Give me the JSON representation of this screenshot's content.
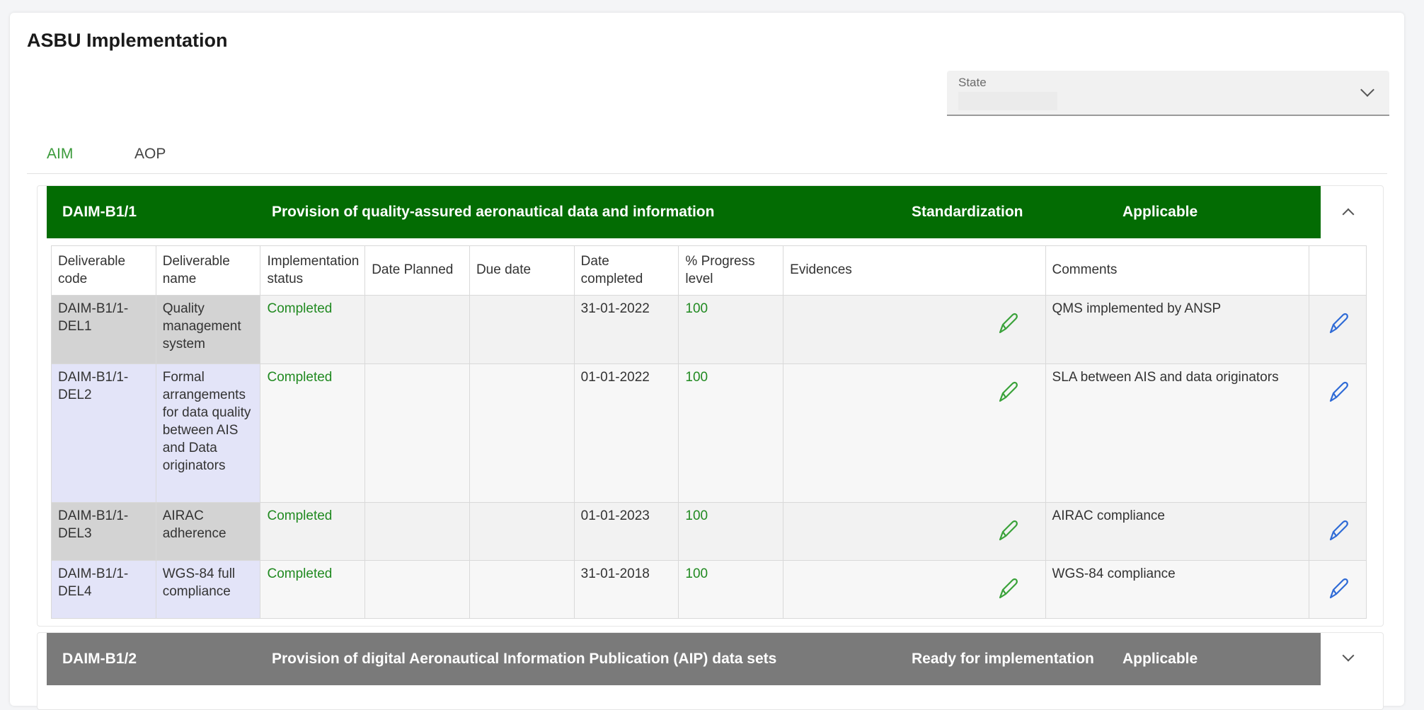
{
  "page": {
    "title": "ASBU Implementation"
  },
  "filters": {
    "state_label": "State",
    "state_value": ""
  },
  "tabs": [
    {
      "label": "AIM",
      "active": true
    },
    {
      "label": "AOP",
      "active": false
    }
  ],
  "colors": {
    "header_active": "#036c03",
    "header_inactive": "#7a7a7a",
    "status_green": "#218a21",
    "edit_blue": "#2f6bd6",
    "evidence_green": "#3aa23a"
  },
  "table": {
    "columns": [
      "Deliverable code",
      "Deliverable name",
      "Implementation status",
      "Date Planned",
      "Due date",
      "Date completed",
      "% Progress level",
      "Evidences",
      "Comments",
      ""
    ]
  },
  "panels": [
    {
      "code": "DAIM-B1/1",
      "title": "Provision of quality-assured aeronautical data and information",
      "status": "Standardization",
      "applicability": "Applicable",
      "expanded": true,
      "rows": [
        {
          "code": "DAIM-B1/1-DEL1",
          "name": "Quality management system",
          "status": "Completed",
          "date_planned": "",
          "due_date": "",
          "date_completed": "31-01-2022",
          "progress": "100",
          "evidence_icon": "pencil-icon",
          "comments": "QMS implemented by ANSP",
          "action_icon": "edit-pencil-icon"
        },
        {
          "code": "DAIM-B1/1-DEL2",
          "name": "Formal arrangements for data quality between AIS and Data originators",
          "status": "Completed",
          "date_planned": "",
          "due_date": "",
          "date_completed": "01-01-2022",
          "progress": "100",
          "evidence_icon": "pencil-icon",
          "comments": "SLA between AIS and data originators",
          "action_icon": "edit-pencil-icon"
        },
        {
          "code": "DAIM-B1/1-DEL3",
          "name": "AIRAC adherence",
          "status": "Completed",
          "date_planned": "",
          "due_date": "",
          "date_completed": "01-01-2023",
          "progress": "100",
          "evidence_icon": "pencil-icon",
          "comments": "AIRAC compliance",
          "action_icon": "edit-pencil-icon"
        },
        {
          "code": "DAIM-B1/1-DEL4",
          "name": "WGS-84 full compliance",
          "status": "Completed",
          "date_planned": "",
          "due_date": "",
          "date_completed": "31-01-2018",
          "progress": "100",
          "evidence_icon": "pencil-icon",
          "comments": "WGS-84 compliance",
          "action_icon": "edit-pencil-icon"
        }
      ]
    },
    {
      "code": "DAIM-B1/2",
      "title": "Provision of digital Aeronautical Information Publication (AIP) data sets",
      "status": "Ready for implementation",
      "applicability": "Applicable",
      "expanded": false,
      "rows": []
    }
  ]
}
